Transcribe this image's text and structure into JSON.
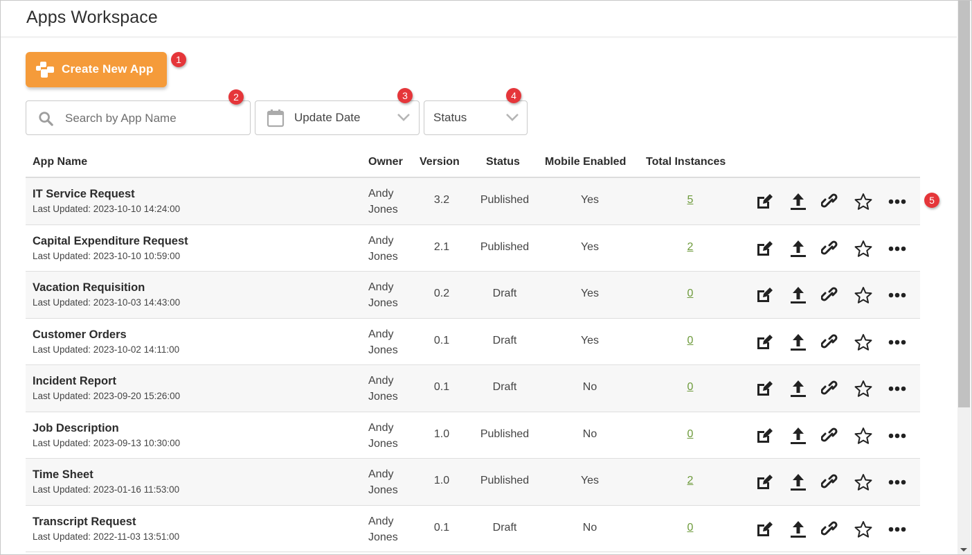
{
  "header": {
    "title": "Apps Workspace"
  },
  "toolbar": {
    "create_label": "Create New App",
    "search_placeholder": "Search by App Name",
    "search_value": "",
    "date_filter_label": "Update Date",
    "status_filter_label": "Status"
  },
  "callouts": [
    "1",
    "2",
    "3",
    "4",
    "5"
  ],
  "colors": {
    "accent": "#f59b3a",
    "badge": "#e5363a",
    "link": "#6d9a3b"
  },
  "table": {
    "columns": [
      "App Name",
      "Owner",
      "Version",
      "Status",
      "Mobile Enabled",
      "Total Instances"
    ],
    "row_actions": [
      "edit-icon",
      "upload-icon",
      "link-icon",
      "star-icon",
      "more-icon"
    ],
    "rows": [
      {
        "name": "IT Service Request",
        "updated": "Last Updated: 2023-10-10 14:24:00",
        "owner_first": "Andy",
        "owner_last": "Jones",
        "version": "3.2",
        "status": "Published",
        "mobile": "Yes",
        "instances": "5"
      },
      {
        "name": "Capital Expenditure Request",
        "updated": "Last Updated: 2023-10-10 10:59:00",
        "owner_first": "Andy",
        "owner_last": "Jones",
        "version": "2.1",
        "status": "Published",
        "mobile": "Yes",
        "instances": "2"
      },
      {
        "name": "Vacation Requisition",
        "updated": "Last Updated: 2023-10-03 14:43:00",
        "owner_first": "Andy",
        "owner_last": "Jones",
        "version": "0.2",
        "status": "Draft",
        "mobile": "Yes",
        "instances": "0"
      },
      {
        "name": "Customer Orders",
        "updated": "Last Updated: 2023-10-02 14:11:00",
        "owner_first": "Andy",
        "owner_last": "Jones",
        "version": "0.1",
        "status": "Draft",
        "mobile": "Yes",
        "instances": "0"
      },
      {
        "name": "Incident Report",
        "updated": "Last Updated: 2023-09-20 15:26:00",
        "owner_first": "Andy",
        "owner_last": "Jones",
        "version": "0.1",
        "status": "Draft",
        "mobile": "No",
        "instances": "0"
      },
      {
        "name": "Job Description",
        "updated": "Last Updated: 2023-09-13 10:30:00",
        "owner_first": "Andy",
        "owner_last": "Jones",
        "version": "1.0",
        "status": "Published",
        "mobile": "No",
        "instances": "0"
      },
      {
        "name": "Time Sheet",
        "updated": "Last Updated: 2023-01-16 11:53:00",
        "owner_first": "Andy",
        "owner_last": "Jones",
        "version": "1.0",
        "status": "Published",
        "mobile": "Yes",
        "instances": "2"
      },
      {
        "name": "Transcript Request",
        "updated": "Last Updated: 2022-11-03 13:51:00",
        "owner_first": "Andy",
        "owner_last": "Jones",
        "version": "0.1",
        "status": "Draft",
        "mobile": "No",
        "instances": "0"
      }
    ]
  }
}
